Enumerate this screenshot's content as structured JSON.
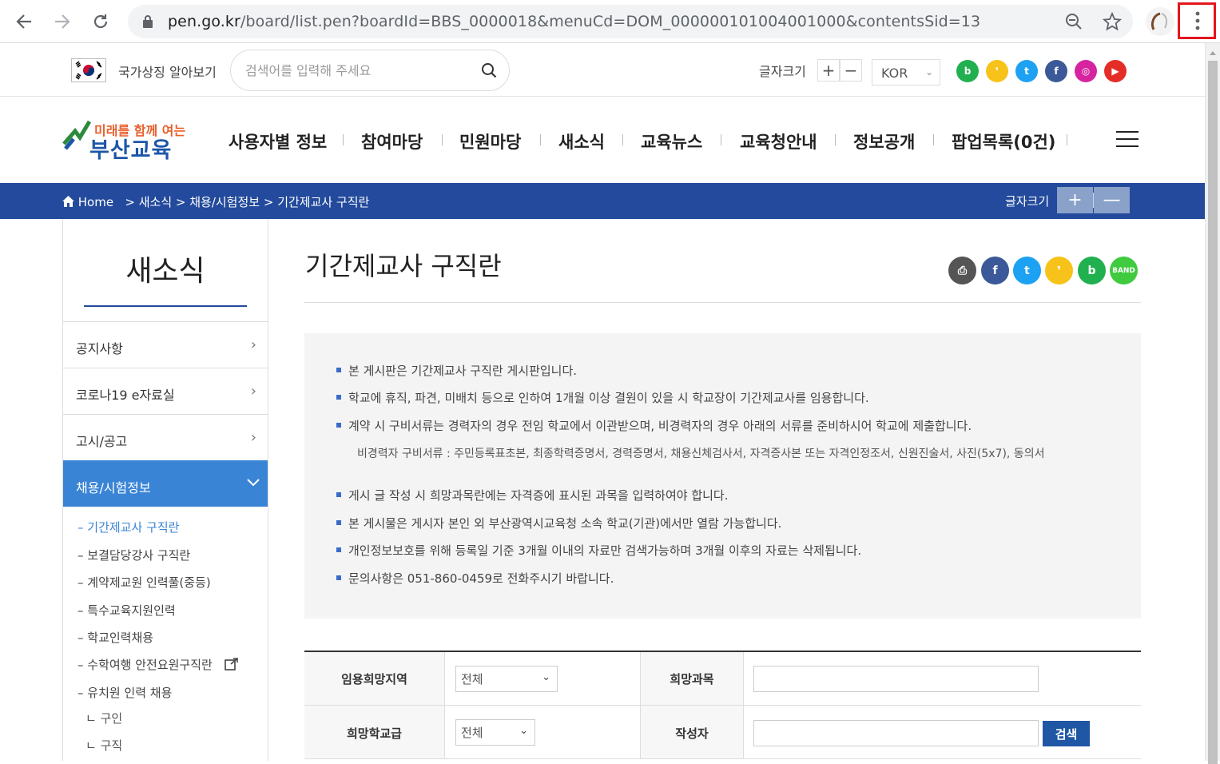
{
  "browser": {
    "url_domain": "pen.go.kr",
    "url_path": "/board/list.pen?boardId=BBS_0000018&menuCd=DOM_000000101004001000&contentsSid=13"
  },
  "utility": {
    "national_symbol_label": "국가상징 알아보기",
    "search_placeholder": "검색어를 입력해 주세요",
    "font_size_label": "글자크기",
    "font_plus": "+",
    "font_minus": "−",
    "language": "KOR",
    "sns": [
      {
        "name": "blog",
        "color": "#21b04f"
      },
      {
        "name": "kakaostory",
        "color": "#f7c31a"
      },
      {
        "name": "twitter",
        "color": "#1da1f2"
      },
      {
        "name": "facebook",
        "color": "#3b5998"
      },
      {
        "name": "instagram",
        "color": "#d6249f"
      },
      {
        "name": "youtube",
        "color": "#e52d27"
      }
    ]
  },
  "header": {
    "logo_small": "미래를 함께 여는",
    "logo_big": "부산교육",
    "menu": [
      "사용자별 정보",
      "참여마당",
      "민원마당",
      "새소식",
      "교육뉴스",
      "교육청안내",
      "정보공개",
      "팝업목록(0건)"
    ]
  },
  "breadcrumb": {
    "home": "Home",
    "path": "> 새소식 > 채용/시험정보 > 기간제교사 구직란",
    "font_size_label": "글자크기",
    "plus": "+",
    "minus": "—"
  },
  "sidebar": {
    "title": "새소식",
    "items": [
      {
        "label": "공지사항"
      },
      {
        "label": "코로나19 e자료실"
      },
      {
        "label": "고시/공고"
      },
      {
        "label": "채용/시험정보"
      }
    ],
    "sub_items": [
      "– 기간제교사 구직란",
      "– 보결담당강사 구직란",
      "– 계약제교원 인력풀(중등)",
      "– 특수교육지원인력",
      "– 학교인력채용",
      "– 수학여행 안전요원구직란",
      "– 유치원 인력 채용"
    ],
    "subsub_items": [
      "ㄴ 구인",
      "ㄴ 구직"
    ]
  },
  "content": {
    "title": "기간제교사 구직란",
    "share": [
      {
        "name": "print",
        "color": "#555555"
      },
      {
        "name": "facebook",
        "color": "#3b5998"
      },
      {
        "name": "twitter",
        "color": "#1da1f2"
      },
      {
        "name": "kakaostory",
        "color": "#f7c31a"
      },
      {
        "name": "blog",
        "color": "#21b04f"
      },
      {
        "name": "band",
        "color": "#3fca3f"
      }
    ],
    "notices": [
      "본 게시판은 기간제교사 구직란 게시판입니다.",
      "학교에 휴직, 파견, 미배치 등으로 인하여 1개월 이상 결원이 있을 시 학교장이 기간제교사를 임용합니다.",
      "계약 시 구비서류는 경력자의 경우 전임 학교에서 이관받으며, 비경력자의 경우 아래의 서류를 준비하시어 학교에 제출합니다.",
      "게시 글 작성 시 희망과목란에는 자격증에 표시된 과목을 입력하여야 합니다.",
      "본 게시물은 게시자 본인 외 부산광역시교육청 소속 학교(기관)에서만 열람 가능합니다.",
      "개인정보보호를 위해 등록일 기준 3개월 이내의 자료만 검색가능하며 3개월 이후의 자료는 삭제됩니다.",
      "문의사항은 051-860-0459로 전화주시기 바랍니다."
    ],
    "notice_sub": "비경력자 구비서류 : 주민등록표초본, 최종학력증명서, 경력증명서, 채용신체검사서, 자격증사본 또는 자격인정조서, 신원진술서, 사진(5x7), 동의서"
  },
  "search": {
    "region_label": "임용희망지역",
    "region_value": "전체",
    "subject_label": "희망과목",
    "level_label": "희망학교급",
    "level_value": "전체",
    "author_label": "작성자",
    "button": "검색"
  }
}
